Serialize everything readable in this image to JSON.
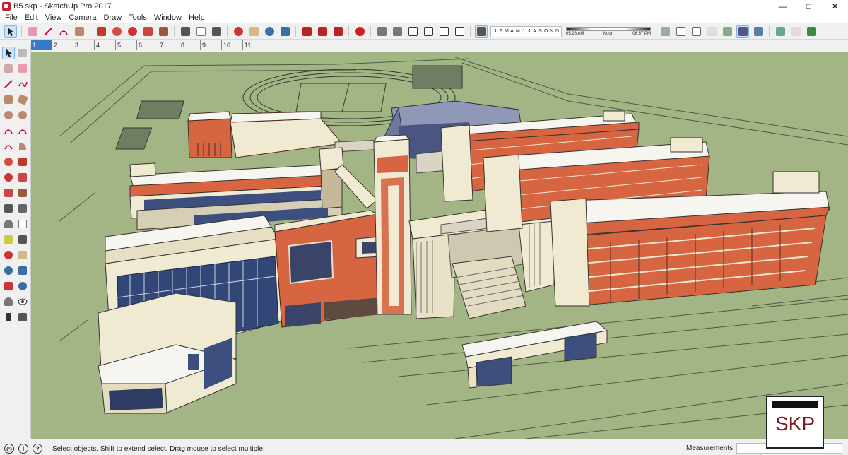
{
  "window": {
    "title": "B5.skp - SketchUp Pro 2017",
    "controls": [
      "minimize",
      "maximize",
      "close"
    ]
  },
  "menu": [
    "File",
    "Edit",
    "View",
    "Camera",
    "Draw",
    "Tools",
    "Window",
    "Help"
  ],
  "shadow_settings": {
    "months": [
      "J",
      "F",
      "M",
      "A",
      "M",
      "J",
      "J",
      "A",
      "S",
      "O",
      "N",
      "D"
    ],
    "sunrise": "05:28 AM",
    "noon": "Noon",
    "sunset": "06:57 PM"
  },
  "scenes": [
    "1",
    "2",
    "3",
    "4",
    "5",
    "6",
    "7",
    "8",
    "9",
    "10",
    "11"
  ],
  "active_scene": "1",
  "status": {
    "hint": "Select objects. Shift to extend select. Drag mouse to select multiple.",
    "measurements_label": "Measurements",
    "measurements_value": ""
  },
  "watermark": "SKP",
  "colors": {
    "ground": "#a3b585",
    "facade_orange": "#d76542",
    "facade_cream": "#f1ead2",
    "roof": "#f7f5ef",
    "glass": "#3c4f7e",
    "accent_blue": "#3a78c8"
  }
}
